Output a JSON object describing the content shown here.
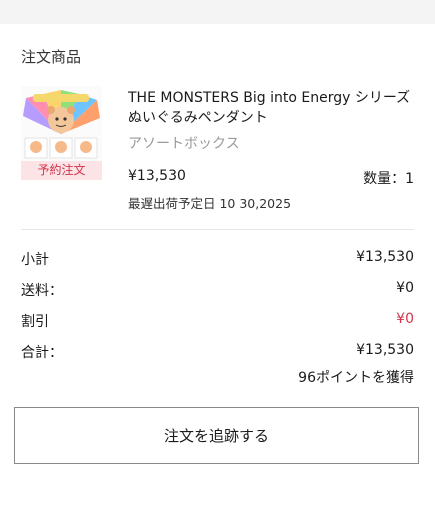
{
  "order": {
    "section_title": "注文商品",
    "product": {
      "name": "THE MONSTERS Big into Energy シリーズ ぬいぐるみペンダント",
      "variant": "アソートボックス",
      "price": "¥13,530",
      "quantity": "数量：1",
      "ship_date": "最遅出荷予定日 10 30,2025",
      "badge": "予約注文",
      "image_alt": "THE MONSTERS product box"
    }
  },
  "summary": {
    "subtotal_label": "小計",
    "subtotal_value": "¥13,530",
    "shipping_label": "送料：",
    "shipping_value": "¥0",
    "discount_label": "割引",
    "discount_value": "¥0",
    "total_label": "合計：",
    "total_value": "¥13,530",
    "points": "96ポイントを獲得"
  },
  "actions": {
    "track_order": "注文を追跡する"
  },
  "colors": {
    "accent_red": "#d4344a",
    "badge_bg": "#fbe3e6",
    "divider": "#e6e6e6"
  }
}
